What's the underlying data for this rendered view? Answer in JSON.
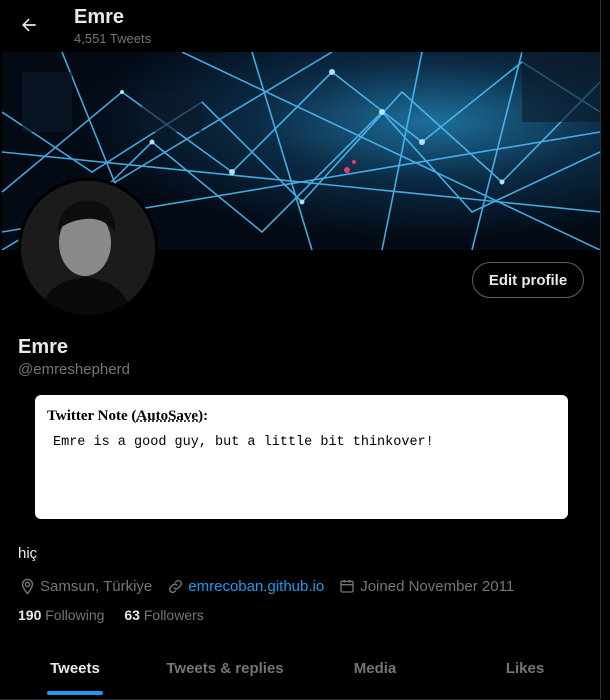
{
  "header": {
    "name": "Emre",
    "tweet_count": "4,551 Tweets"
  },
  "profile": {
    "display_name": "Emre",
    "handle": "@emreshepherd",
    "edit_profile_label": "Edit profile",
    "bio": "hiç",
    "location": "Samsun, Türkiye",
    "website": "emrecoban.github.io",
    "joined": "Joined November 2011",
    "following_count": "190",
    "following_label": "Following",
    "followers_count": "63",
    "followers_label": "Followers"
  },
  "note": {
    "title_prefix": "Twitter Note (",
    "title_link": "AutoSave",
    "title_suffix": "):",
    "body": "Emre is a good guy, but a little bit thinkover!"
  },
  "tabs": [
    {
      "label": "Tweets",
      "active": true
    },
    {
      "label": "Tweets & replies",
      "active": false
    },
    {
      "label": "Media",
      "active": false
    },
    {
      "label": "Likes",
      "active": false
    }
  ],
  "colors": {
    "accent": "#1d9bf0",
    "muted": "#71767b",
    "text": "#e7e9ea",
    "background": "#000000"
  }
}
